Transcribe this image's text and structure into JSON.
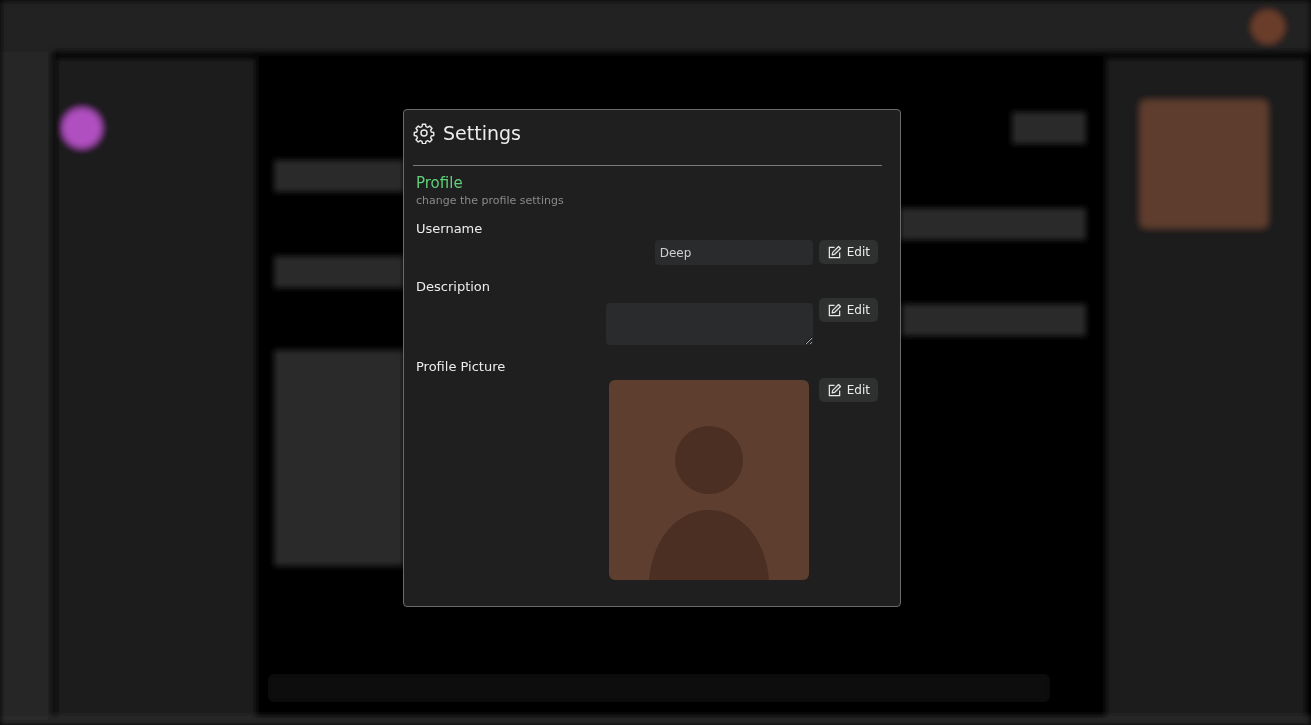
{
  "dialog": {
    "title": "Settings",
    "section": {
      "title": "Profile",
      "subtitle": "change the profile settings"
    },
    "fields": [
      {
        "kind": "text",
        "label": "Username",
        "value": "Deep",
        "button": "Edit"
      },
      {
        "kind": "textarea",
        "label": "Description",
        "button": "Edit"
      },
      {
        "kind": "image",
        "label": "Profile Picture",
        "button": "Edit"
      }
    ]
  }
}
